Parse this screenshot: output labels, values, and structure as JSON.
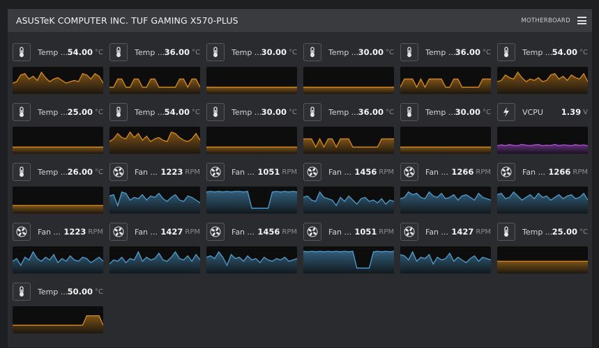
{
  "header": {
    "title": "ASUSTeK COMPUTER INC. TUF GAMING X570-PLUS",
    "tag": "MOTHERBOARD"
  },
  "colors": {
    "temp": "#d88b1f",
    "fan": "#4f9fd1",
    "voltage": "#b04fd8"
  },
  "tiles": [
    {
      "icon": "thermometer-icon",
      "label": "Temp ...",
      "value": "54.00",
      "unit": "°C",
      "type": "temp",
      "spark": [
        0.4,
        0.45,
        0.7,
        0.75,
        0.55,
        0.65,
        0.5,
        0.8,
        0.6,
        0.45,
        0.55,
        0.6,
        0.5,
        0.4,
        0.45,
        0.5,
        0.45,
        0.75,
        0.7,
        0.55,
        0.75,
        0.65,
        0.4
      ]
    },
    {
      "icon": "thermometer-icon",
      "label": "Temp ...",
      "value": "36.00",
      "unit": "°C",
      "type": "temp",
      "spark": [
        0.25,
        0.25,
        0.55,
        0.55,
        0.25,
        0.25,
        0.55,
        0.55,
        0.25,
        0.25,
        0.55,
        0.55,
        0.25,
        0.25,
        0.25,
        0.25,
        0.25,
        0.55,
        0.55,
        0.25,
        0.55,
        0.55,
        0.25
      ]
    },
    {
      "icon": "thermometer-icon",
      "label": "Temp ...",
      "value": "30.00",
      "unit": "°C",
      "type": "temp",
      "spark": [
        0.25,
        0.25,
        0.25,
        0.25,
        0.25,
        0.25,
        0.25,
        0.25,
        0.25,
        0.25,
        0.25,
        0.25,
        0.25,
        0.25,
        0.25,
        0.25,
        0.25,
        0.25,
        0.25,
        0.25,
        0.25,
        0.25,
        0.25
      ]
    },
    {
      "icon": "thermometer-icon",
      "label": "Temp ...",
      "value": "30.00",
      "unit": "°C",
      "type": "temp",
      "spark": [
        0.25,
        0.25,
        0.25,
        0.25,
        0.25,
        0.25,
        0.25,
        0.25,
        0.25,
        0.25,
        0.25,
        0.25,
        0.25,
        0.25,
        0.25,
        0.25,
        0.25,
        0.25,
        0.25,
        0.25,
        0.25,
        0.25,
        0.25
      ]
    },
    {
      "icon": "thermometer-icon",
      "label": "Temp ...",
      "value": "36.00",
      "unit": "°C",
      "type": "temp",
      "spark": [
        0.25,
        0.55,
        0.55,
        0.55,
        0.25,
        0.55,
        0.25,
        0.55,
        0.55,
        0.55,
        0.55,
        0.25,
        0.25,
        0.55,
        0.55,
        0.25,
        0.25,
        0.25,
        0.25,
        0.25,
        0.55,
        0.55,
        0.55
      ]
    },
    {
      "icon": "thermometer-icon",
      "label": "Temp ...",
      "value": "54.00",
      "unit": "°C",
      "type": "temp",
      "spark": [
        0.45,
        0.5,
        0.7,
        0.6,
        0.55,
        0.8,
        0.6,
        0.45,
        0.55,
        0.5,
        0.6,
        0.45,
        0.5,
        0.7,
        0.75,
        0.55,
        0.65,
        0.5,
        0.7,
        0.6,
        0.55,
        0.75,
        0.45
      ]
    },
    {
      "icon": "thermometer-icon",
      "label": "Temp ...",
      "value": "25.00",
      "unit": "°C",
      "type": "temp",
      "spark": [
        0.25,
        0.25,
        0.25,
        0.25,
        0.25,
        0.25,
        0.25,
        0.25,
        0.25,
        0.25,
        0.25,
        0.25,
        0.25,
        0.25,
        0.25,
        0.25,
        0.25,
        0.25,
        0.25,
        0.25,
        0.25,
        0.25,
        0.25
      ]
    },
    {
      "icon": "thermometer-icon",
      "label": "Temp ...",
      "value": "54.00",
      "unit": "°C",
      "type": "temp",
      "spark": [
        0.45,
        0.55,
        0.75,
        0.6,
        0.55,
        0.8,
        0.6,
        0.75,
        0.5,
        0.65,
        0.45,
        0.55,
        0.6,
        0.5,
        0.45,
        0.8,
        0.75,
        0.6,
        0.5,
        0.45,
        0.55,
        0.75,
        0.5
      ]
    },
    {
      "icon": "thermometer-icon",
      "label": "Temp ...",
      "value": "30.00",
      "unit": "°C",
      "type": "temp",
      "spark": [
        0.25,
        0.25,
        0.25,
        0.25,
        0.25,
        0.25,
        0.25,
        0.25,
        0.25,
        0.25,
        0.25,
        0.25,
        0.25,
        0.25,
        0.25,
        0.25,
        0.25,
        0.25,
        0.25,
        0.25,
        0.25,
        0.25,
        0.25
      ]
    },
    {
      "icon": "thermometer-icon",
      "label": "Temp ...",
      "value": "36.00",
      "unit": "°C",
      "type": "temp",
      "spark": [
        0.55,
        0.55,
        0.55,
        0.25,
        0.55,
        0.25,
        0.55,
        0.55,
        0.25,
        0.55,
        0.55,
        0.55,
        0.25,
        0.25,
        0.25,
        0.25,
        0.25,
        0.25,
        0.25,
        0.55,
        0.55,
        0.55,
        0.55
      ]
    },
    {
      "icon": "thermometer-icon",
      "label": "Temp ...",
      "value": "30.00",
      "unit": "°C",
      "type": "temp",
      "spark": [
        0.25,
        0.25,
        0.25,
        0.25,
        0.25,
        0.25,
        0.25,
        0.25,
        0.25,
        0.25,
        0.25,
        0.25,
        0.25,
        0.25,
        0.25,
        0.25,
        0.25,
        0.25,
        0.25,
        0.25,
        0.25,
        0.25,
        0.25
      ]
    },
    {
      "icon": "lightning-icon",
      "label": "VCPU",
      "value": "1.39",
      "unit": "V",
      "type": "voltage",
      "spark": [
        0.3,
        0.33,
        0.3,
        0.34,
        0.31,
        0.3,
        0.35,
        0.32,
        0.3,
        0.33,
        0.34,
        0.3,
        0.32,
        0.31,
        0.35,
        0.3,
        0.33,
        0.32,
        0.3,
        0.34,
        0.31,
        0.33,
        0.3
      ]
    },
    {
      "icon": "thermometer-icon",
      "label": "Temp ...",
      "value": "26.00",
      "unit": "°C",
      "type": "temp",
      "spark": [
        0.3,
        0.3,
        0.3,
        0.3,
        0.3,
        0.3,
        0.3,
        0.3,
        0.3,
        0.3,
        0.3,
        0.3,
        0.3,
        0.3,
        0.3,
        0.3,
        0.3,
        0.3,
        0.3,
        0.3,
        0.3,
        0.3,
        0.3
      ]
    },
    {
      "icon": "fan-icon",
      "label": "Fan ...",
      "value": "1223",
      "unit": "RPM",
      "type": "fan",
      "spark": [
        0.65,
        0.7,
        0.3,
        0.8,
        0.75,
        0.5,
        0.6,
        0.55,
        0.7,
        0.5,
        0.65,
        0.6,
        0.75,
        0.55,
        0.45,
        0.6,
        0.7,
        0.5,
        0.45,
        0.65,
        0.6,
        0.5,
        0.4
      ]
    },
    {
      "icon": "fan-icon",
      "label": "Fan ...",
      "value": "1051",
      "unit": "RPM",
      "type": "fan",
      "spark": [
        0.8,
        0.82,
        0.8,
        0.82,
        0.8,
        0.82,
        0.8,
        0.82,
        0.82,
        0.8,
        0.82,
        0.2,
        0.2,
        0.2,
        0.2,
        0.2,
        0.8,
        0.82,
        0.8,
        0.82,
        0.8,
        0.82,
        0.8
      ]
    },
    {
      "icon": "fan-icon",
      "label": "Fan ...",
      "value": "1456",
      "unit": "RPM",
      "type": "fan",
      "spark": [
        0.6,
        0.65,
        0.5,
        0.45,
        0.8,
        0.6,
        0.55,
        0.5,
        0.3,
        0.6,
        0.45,
        0.65,
        0.5,
        0.35,
        0.55,
        0.6,
        0.45,
        0.5,
        0.4,
        0.55,
        0.35,
        0.5,
        0.45
      ]
    },
    {
      "icon": "fan-icon",
      "label": "Fan ...",
      "value": "1266",
      "unit": "RPM",
      "type": "fan",
      "spark": [
        0.55,
        0.6,
        0.8,
        0.7,
        0.75,
        0.6,
        0.55,
        0.8,
        0.65,
        0.6,
        0.75,
        0.55,
        0.6,
        0.7,
        0.5,
        0.65,
        0.7,
        0.6,
        0.5,
        0.75,
        0.6,
        0.55,
        0.5
      ]
    },
    {
      "icon": "fan-icon",
      "label": "Fan ...",
      "value": "1266",
      "unit": "RPM",
      "type": "fan",
      "spark": [
        0.7,
        0.75,
        0.55,
        0.6,
        0.8,
        0.65,
        0.5,
        0.6,
        0.7,
        0.55,
        0.75,
        0.6,
        0.65,
        0.5,
        0.6,
        0.7,
        0.55,
        0.65,
        0.7,
        0.55,
        0.6,
        0.75,
        0.5
      ]
    },
    {
      "icon": "fan-icon",
      "label": "Fan ...",
      "value": "1223",
      "unit": "RPM",
      "type": "fan",
      "spark": [
        0.45,
        0.55,
        0.3,
        0.6,
        0.5,
        0.8,
        0.55,
        0.45,
        0.6,
        0.5,
        0.7,
        0.4,
        0.55,
        0.45,
        0.65,
        0.5,
        0.45,
        0.6,
        0.55,
        0.4,
        0.5,
        0.6,
        0.45
      ]
    },
    {
      "icon": "fan-icon",
      "label": "Fan ...",
      "value": "1427",
      "unit": "RPM",
      "type": "fan",
      "spark": [
        0.35,
        0.5,
        0.45,
        0.6,
        0.4,
        0.55,
        0.5,
        0.8,
        0.45,
        0.6,
        0.5,
        0.55,
        0.75,
        0.5,
        0.45,
        0.6,
        0.8,
        0.55,
        0.5,
        0.65,
        0.45,
        0.7,
        0.5
      ]
    },
    {
      "icon": "fan-icon",
      "label": "Fan ...",
      "value": "1456",
      "unit": "RPM",
      "type": "fan",
      "spark": [
        0.6,
        0.65,
        0.55,
        0.8,
        0.6,
        0.3,
        0.7,
        0.55,
        0.6,
        0.45,
        0.65,
        0.5,
        0.55,
        0.4,
        0.6,
        0.5,
        0.45,
        0.55,
        0.5,
        0.6,
        0.45,
        0.5,
        0.55
      ]
    },
    {
      "icon": "fan-icon",
      "label": "Fan ...",
      "value": "1051",
      "unit": "RPM",
      "type": "fan",
      "spark": [
        0.82,
        0.8,
        0.82,
        0.8,
        0.82,
        0.8,
        0.82,
        0.8,
        0.82,
        0.8,
        0.82,
        0.8,
        0.82,
        0.2,
        0.2,
        0.2,
        0.2,
        0.8,
        0.82,
        0.8,
        0.82,
        0.8,
        0.82
      ]
    },
    {
      "icon": "fan-icon",
      "label": "Fan ...",
      "value": "1427",
      "unit": "RPM",
      "type": "fan",
      "spark": [
        0.7,
        0.65,
        0.5,
        0.8,
        0.45,
        0.6,
        0.55,
        0.7,
        0.35,
        0.6,
        0.5,
        0.55,
        0.75,
        0.45,
        0.6,
        0.5,
        0.4,
        0.55,
        0.65,
        0.45,
        0.6,
        0.55,
        0.5
      ]
    },
    {
      "icon": "thermometer-icon",
      "label": "Temp ...",
      "value": "25.00",
      "unit": "°C",
      "type": "temp",
      "spark": [
        0.45,
        0.45,
        0.45,
        0.45,
        0.45,
        0.45,
        0.45,
        0.45,
        0.45,
        0.45,
        0.45,
        0.45,
        0.45,
        0.45,
        0.45,
        0.45,
        0.45,
        0.45,
        0.45,
        0.45,
        0.45,
        0.45,
        0.45
      ]
    },
    {
      "icon": "thermometer-icon",
      "label": "Temp ...",
      "value": "50.00",
      "unit": "°C",
      "type": "temp",
      "spark": [
        0.3,
        0.3,
        0.3,
        0.3,
        0.3,
        0.3,
        0.3,
        0.3,
        0.3,
        0.3,
        0.3,
        0.3,
        0.3,
        0.3,
        0.3,
        0.3,
        0.3,
        0.3,
        0.65,
        0.65,
        0.65,
        0.65,
        0.3
      ]
    }
  ]
}
